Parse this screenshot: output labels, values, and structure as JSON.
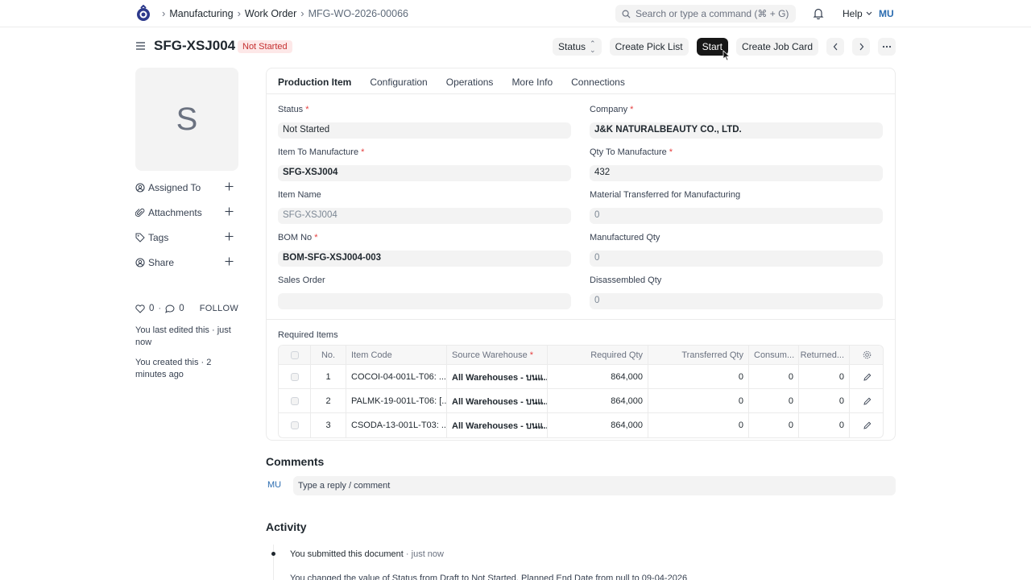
{
  "navbar": {
    "breadcrumbs": [
      "Manufacturing",
      "Work Order",
      "MFG-WO-2026-00066"
    ],
    "search_placeholder": "Search or type a command (⌘ + G)",
    "help_label": "Help",
    "user_initials": "MU"
  },
  "header": {
    "title": "SFG-XSJ004",
    "status_badge": "Not Started",
    "actions": {
      "status": "Status",
      "create_pick_list": "Create Pick List",
      "start": "Start",
      "create_job_card": "Create Job Card"
    }
  },
  "sidebar": {
    "image_letter": "S",
    "items": [
      {
        "label": "Assigned To",
        "icon": "assign-icon"
      },
      {
        "label": "Attachments",
        "icon": "paperclip-icon"
      },
      {
        "label": "Tags",
        "icon": "tag-icon"
      },
      {
        "label": "Share",
        "icon": "share-icon"
      }
    ],
    "likes": "0",
    "comments": "0",
    "follow": "FOLLOW",
    "last_edited": "You last edited this · just now",
    "created": "You created this · 2 minutes ago"
  },
  "tabs": [
    "Production Item",
    "Configuration",
    "Operations",
    "More Info",
    "Connections"
  ],
  "form": {
    "status": {
      "label": "Status",
      "value": "Not Started"
    },
    "company": {
      "label": "Company",
      "value": "J&K NATURALBEAUTY CO., LTD."
    },
    "item_to_manufacture": {
      "label": "Item To Manufacture",
      "value": "SFG-XSJ004"
    },
    "qty_to_manufacture": {
      "label": "Qty To Manufacture",
      "value": "432"
    },
    "item_name": {
      "label": "Item Name",
      "value": "SFG-XSJ004"
    },
    "material_transferred": {
      "label": "Material Transferred for Manufacturing",
      "value": "0"
    },
    "bom_no": {
      "label": "BOM No",
      "value": "BOM-SFG-XSJ004-003"
    },
    "manufactured_qty": {
      "label": "Manufactured Qty",
      "value": "0"
    },
    "sales_order": {
      "label": "Sales Order",
      "value": ""
    },
    "disassembled_qty": {
      "label": "Disassembled Qty",
      "value": "0"
    }
  },
  "required_items": {
    "title": "Required Items",
    "columns": [
      "No.",
      "Item Code",
      "Source Warehouse",
      "Required Qty",
      "Transferred Qty",
      "Consum...",
      "Returned..."
    ],
    "rows": [
      {
        "no": "1",
        "item_code": "COCOI-04-001L-T06: ...",
        "warehouse": "All Warehouses - บนแ...",
        "required": "864,000",
        "transferred": "0",
        "consumed": "0",
        "returned": "0"
      },
      {
        "no": "2",
        "item_code": "PALMK-19-001L-T06: [...",
        "warehouse": "All Warehouses - บนแ...",
        "required": "864,000",
        "transferred": "0",
        "consumed": "0",
        "returned": "0"
      },
      {
        "no": "3",
        "item_code": "CSODA-13-001L-T03: ...",
        "warehouse": "All Warehouses - บนแ...",
        "required": "864,000",
        "transferred": "0",
        "consumed": "0",
        "returned": "0"
      }
    ]
  },
  "comments": {
    "title": "Comments",
    "user_initials": "MU",
    "placeholder": "Type a reply / comment"
  },
  "activity": {
    "title": "Activity",
    "item1_text": "You submitted this document",
    "item1_time": " · just now",
    "item2_text": "You changed the value of Status from Draft to Not Started, Planned End Date from null to 09-04-2026"
  }
}
